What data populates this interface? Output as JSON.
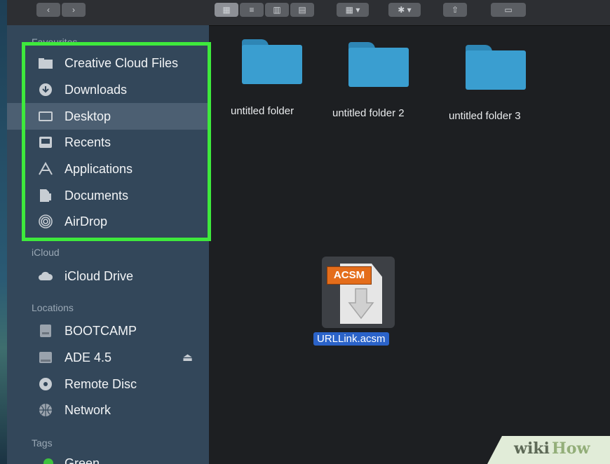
{
  "sidebar": {
    "sections": {
      "favourites": "Favourites",
      "icloud": "iCloud",
      "locations": "Locations",
      "tags": "Tags"
    },
    "favourites": [
      {
        "label": "Creative Cloud Files",
        "icon": "folder-icon"
      },
      {
        "label": "Downloads",
        "icon": "download-icon"
      },
      {
        "label": "Desktop",
        "icon": "desktop-icon",
        "selected": true
      },
      {
        "label": "Recents",
        "icon": "recents-icon"
      },
      {
        "label": "Applications",
        "icon": "applications-icon"
      },
      {
        "label": "Documents",
        "icon": "documents-icon"
      },
      {
        "label": "AirDrop",
        "icon": "airdrop-icon"
      }
    ],
    "icloud": [
      {
        "label": "iCloud Drive",
        "icon": "cloud-icon"
      }
    ],
    "locations": [
      {
        "label": "BOOTCAMP",
        "icon": "disk-icon"
      },
      {
        "label": "ADE 4.5",
        "icon": "disk-icon",
        "eject": "⏏"
      },
      {
        "label": "Remote Disc",
        "icon": "disc-icon"
      },
      {
        "label": "Network",
        "icon": "network-icon"
      }
    ],
    "tags": [
      {
        "label": "Green",
        "color": "#3ec23e"
      }
    ],
    "highlight_color": "#3ee93c"
  },
  "content": {
    "folders": [
      {
        "label": "untitled folder"
      },
      {
        "label": "untitled folder 2"
      },
      {
        "label": "untitled folder 3"
      }
    ],
    "file": {
      "badge": "ACSM",
      "name": "URLLink.acsm"
    }
  },
  "watermark": {
    "part1": "wiki",
    "part2": "How"
  }
}
